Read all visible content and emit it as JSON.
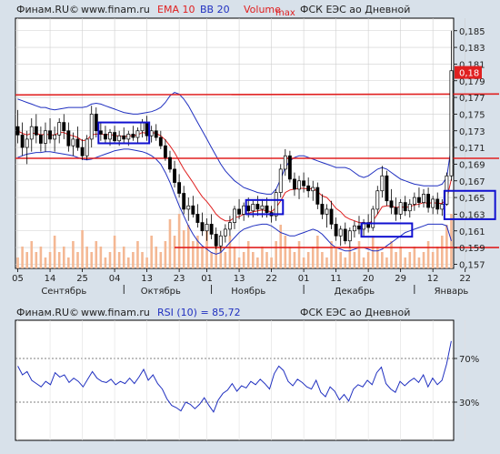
{
  "main_header": {
    "source": "Финам.RU©",
    "site": "www.finam.ru",
    "ema": "EMA 10",
    "bb": "BB 20",
    "volume": "Volume",
    "max": "max",
    "ticker": "ФСК ЕЭС ао Дневной"
  },
  "rsi_header": {
    "source": "Финам.RU©",
    "site": "www.finam.ru",
    "rsi": "RSI (10) = 85,72",
    "ticker": "ФСК ЕЭС ао Дневной"
  },
  "colors": {
    "background": "#d8e1ea",
    "plot": "#ffffff",
    "candle_up": "#ffffff",
    "candle_down": "#000000",
    "ema": "#e02020",
    "bollinger": "#2030c0",
    "volume": "#f4b894",
    "levels": "#e02020",
    "boxes": "#1010d0",
    "rsi": "#2030c0",
    "last_price_bg": "#e02020"
  },
  "chart_data": [
    {
      "type": "candlestick",
      "title": "ФСК ЕЭС ао Дневной",
      "ylim": [
        0.1565,
        0.1865
      ],
      "y_ticks": [
        "0,185",
        "0,183",
        "0,181",
        "0,179",
        "0,177",
        "0,175",
        "0,173",
        "0,171",
        "0,169",
        "0,167",
        "0,165",
        "0,163",
        "0,161",
        "0,159",
        "0,157"
      ],
      "y_tick_values": [
        0.185,
        0.183,
        0.181,
        0.179,
        0.177,
        0.175,
        0.173,
        0.171,
        0.169,
        0.167,
        0.165,
        0.163,
        0.161,
        0.159,
        0.157
      ],
      "x_ticks": [
        "05",
        "14",
        "25",
        "04",
        "13",
        "23",
        "01",
        "13",
        "22",
        "01",
        "11",
        "20",
        "29",
        "12",
        "22"
      ],
      "months": [
        "Сентябрь",
        "Октябрь",
        "Ноябрь",
        "Декабрь",
        "Январь"
      ],
      "last_price_label": "0,18",
      "last_price": 0.18,
      "horizontal_levels": [
        0.1773,
        0.1697,
        0.159
      ],
      "legend": [
        "EMA 10",
        "BB 20",
        "Volume",
        "max"
      ],
      "grid": true,
      "candles": [
        [
          0.1735,
          0.1755,
          0.1715,
          0.1725
        ],
        [
          0.1725,
          0.174,
          0.17,
          0.171
        ],
        [
          0.171,
          0.173,
          0.169,
          0.172
        ],
        [
          0.172,
          0.1745,
          0.1705,
          0.1735
        ],
        [
          0.1735,
          0.175,
          0.1715,
          0.1725
        ],
        [
          0.1725,
          0.1735,
          0.1705,
          0.1715
        ],
        [
          0.1715,
          0.174,
          0.1705,
          0.173
        ],
        [
          0.173,
          0.1745,
          0.1715,
          0.172
        ],
        [
          0.172,
          0.1735,
          0.1705,
          0.1725
        ],
        [
          0.1725,
          0.1745,
          0.1715,
          0.174
        ],
        [
          0.174,
          0.175,
          0.172,
          0.173
        ],
        [
          0.173,
          0.174,
          0.1705,
          0.1712
        ],
        [
          0.1712,
          0.1728,
          0.17,
          0.172
        ],
        [
          0.172,
          0.1735,
          0.1706,
          0.171
        ],
        [
          0.171,
          0.172,
          0.1695,
          0.17
        ],
        [
          0.17,
          0.1725,
          0.1695,
          0.172
        ],
        [
          0.172,
          0.176,
          0.171,
          0.175
        ],
        [
          0.175,
          0.1758,
          0.1722,
          0.173
        ],
        [
          0.173,
          0.174,
          0.1718,
          0.1726
        ],
        [
          0.1726,
          0.1736,
          0.1714,
          0.172
        ],
        [
          0.172,
          0.1732,
          0.1712,
          0.1728
        ],
        [
          0.1728,
          0.1736,
          0.1714,
          0.1718
        ],
        [
          0.1718,
          0.173,
          0.1712,
          0.1724
        ],
        [
          0.1724,
          0.1734,
          0.1716,
          0.172
        ],
        [
          0.172,
          0.173,
          0.1712,
          0.1726
        ],
        [
          0.1726,
          0.1736,
          0.1718,
          0.1722
        ],
        [
          0.1722,
          0.1734,
          0.1716,
          0.173
        ],
        [
          0.173,
          0.1744,
          0.1722,
          0.174
        ],
        [
          0.174,
          0.1748,
          0.1718,
          0.1724
        ],
        [
          0.1724,
          0.1736,
          0.1716,
          0.173
        ],
        [
          0.173,
          0.1738,
          0.1718,
          0.1722
        ],
        [
          0.1722,
          0.173,
          0.1708,
          0.1712
        ],
        [
          0.1712,
          0.172,
          0.1694,
          0.1698
        ],
        [
          0.1698,
          0.1706,
          0.168,
          0.1684
        ],
        [
          0.1684,
          0.1694,
          0.1662,
          0.1668
        ],
        [
          0.1668,
          0.1678,
          0.165,
          0.1655
        ],
        [
          0.1655,
          0.1664,
          0.163,
          0.1636
        ],
        [
          0.1636,
          0.165,
          0.1622,
          0.164
        ],
        [
          0.164,
          0.1652,
          0.1626,
          0.163
        ],
        [
          0.163,
          0.1642,
          0.1614,
          0.162
        ],
        [
          0.162,
          0.1632,
          0.1604,
          0.161
        ],
        [
          0.161,
          0.1625,
          0.1598,
          0.1618
        ],
        [
          0.1618,
          0.163,
          0.16,
          0.1606
        ],
        [
          0.1606,
          0.1614,
          0.1588,
          0.1592
        ],
        [
          0.1592,
          0.161,
          0.1585,
          0.1604
        ],
        [
          0.1604,
          0.1618,
          0.1596,
          0.1612
        ],
        [
          0.1612,
          0.1628,
          0.1604,
          0.162
        ],
        [
          0.162,
          0.164,
          0.1612,
          0.1636
        ],
        [
          0.1636,
          0.1648,
          0.1624,
          0.163
        ],
        [
          0.163,
          0.1644,
          0.1622,
          0.164
        ],
        [
          0.164,
          0.165,
          0.1626,
          0.1634
        ],
        [
          0.1634,
          0.1646,
          0.1626,
          0.1642
        ],
        [
          0.1642,
          0.1652,
          0.1628,
          0.1636
        ],
        [
          0.1636,
          0.1648,
          0.1626,
          0.164
        ],
        [
          0.164,
          0.165,
          0.1626,
          0.1632
        ],
        [
          0.1632,
          0.164,
          0.162,
          0.1628
        ],
        [
          0.1628,
          0.166,
          0.1622,
          0.1656
        ],
        [
          0.1656,
          0.169,
          0.165,
          0.1684
        ],
        [
          0.1684,
          0.1708,
          0.1676,
          0.17
        ],
        [
          0.17,
          0.1706,
          0.1668,
          0.1672
        ],
        [
          0.1672,
          0.168,
          0.1652,
          0.166
        ],
        [
          0.166,
          0.1676,
          0.1648,
          0.167
        ],
        [
          0.167,
          0.168,
          0.1656,
          0.1664
        ],
        [
          0.1664,
          0.1674,
          0.165,
          0.1658
        ],
        [
          0.1658,
          0.167,
          0.1646,
          0.1662
        ],
        [
          0.1662,
          0.1668,
          0.1636,
          0.1642
        ],
        [
          0.1642,
          0.1654,
          0.1624,
          0.163
        ],
        [
          0.163,
          0.1642,
          0.1614,
          0.1636
        ],
        [
          0.1636,
          0.1646,
          0.1612,
          0.1618
        ],
        [
          0.1618,
          0.1626,
          0.1598,
          0.1604
        ],
        [
          0.1604,
          0.1616,
          0.1592,
          0.1612
        ],
        [
          0.1612,
          0.162,
          0.1594,
          0.1598
        ],
        [
          0.1598,
          0.1614,
          0.159,
          0.161
        ],
        [
          0.161,
          0.1622,
          0.1602,
          0.1616
        ],
        [
          0.1616,
          0.1628,
          0.1606,
          0.1612
        ],
        [
          0.1612,
          0.1624,
          0.1604,
          0.162
        ],
        [
          0.162,
          0.163,
          0.1608,
          0.1614
        ],
        [
          0.1614,
          0.164,
          0.161,
          0.1636
        ],
        [
          0.1636,
          0.1664,
          0.163,
          0.1658
        ],
        [
          0.1658,
          0.1688,
          0.165,
          0.1676
        ],
        [
          0.1676,
          0.1682,
          0.164,
          0.1646
        ],
        [
          0.1646,
          0.166,
          0.163,
          0.1638
        ],
        [
          0.1638,
          0.165,
          0.1622,
          0.163
        ],
        [
          0.163,
          0.1648,
          0.1624,
          0.1644
        ],
        [
          0.1644,
          0.1652,
          0.1628,
          0.1634
        ],
        [
          0.1634,
          0.1648,
          0.1626,
          0.1642
        ],
        [
          0.1642,
          0.1656,
          0.1634,
          0.165
        ],
        [
          0.165,
          0.1662,
          0.1638,
          0.1644
        ],
        [
          0.1644,
          0.166,
          0.1638,
          0.1654
        ],
        [
          0.1654,
          0.1662,
          0.1632,
          0.1638
        ],
        [
          0.1638,
          0.1652,
          0.163,
          0.1648
        ],
        [
          0.1648,
          0.1656,
          0.163,
          0.1636
        ],
        [
          0.1636,
          0.1648,
          0.1628,
          0.1642
        ],
        [
          0.1642,
          0.168,
          0.164,
          0.1676
        ],
        [
          0.1676,
          0.185,
          0.167,
          0.1802
        ]
      ],
      "ema": [
        0.173,
        0.1727,
        0.1725,
        0.1727,
        0.1727,
        0.1725,
        0.1726,
        0.1725,
        0.1725,
        0.1728,
        0.1728,
        0.1725,
        0.1724,
        0.1722,
        0.1718,
        0.1719,
        0.1725,
        0.1726,
        0.1726,
        0.1725,
        0.1726,
        0.1724,
        0.1724,
        0.1723,
        0.1724,
        0.1724,
        0.1725,
        0.1728,
        0.1727,
        0.1728,
        0.1727,
        0.1724,
        0.1719,
        0.1712,
        0.1704,
        0.1694,
        0.1684,
        0.1676,
        0.1668,
        0.1659,
        0.1651,
        0.1645,
        0.1638,
        0.163,
        0.1625,
        0.1622,
        0.1622,
        0.1626,
        0.1627,
        0.163,
        0.1631,
        0.1633,
        0.1634,
        0.1635,
        0.1634,
        0.1633,
        0.1638,
        0.1646,
        0.1656,
        0.1659,
        0.166,
        0.1661,
        0.1661,
        0.166,
        0.1661,
        0.1657,
        0.1652,
        0.165,
        0.1644,
        0.1637,
        0.1633,
        0.1627,
        0.1624,
        0.1622,
        0.162,
        0.162,
        0.1619,
        0.1622,
        0.163,
        0.1639,
        0.164,
        0.164,
        0.1638,
        0.1639,
        0.1638,
        0.1639,
        0.1641,
        0.1642,
        0.1644,
        0.1643,
        0.1644,
        0.1643,
        0.1643,
        0.1648,
        0.1672
      ],
      "bb_upper": [
        0.1768,
        0.1766,
        0.1764,
        0.1762,
        0.176,
        0.1758,
        0.1758,
        0.1756,
        0.1755,
        0.1756,
        0.1757,
        0.1758,
        0.1758,
        0.1758,
        0.1758,
        0.1759,
        0.1762,
        0.1763,
        0.1762,
        0.176,
        0.1758,
        0.1756,
        0.1754,
        0.1752,
        0.1751,
        0.175,
        0.175,
        0.1751,
        0.1752,
        0.1753,
        0.1755,
        0.1758,
        0.1764,
        0.1772,
        0.1776,
        0.1774,
        0.1768,
        0.176,
        0.175,
        0.174,
        0.173,
        0.172,
        0.171,
        0.17,
        0.169,
        0.1682,
        0.1676,
        0.167,
        0.1666,
        0.1662,
        0.166,
        0.1658,
        0.1656,
        0.1655,
        0.1654,
        0.1654,
        0.166,
        0.1672,
        0.1686,
        0.1694,
        0.1698,
        0.17,
        0.17,
        0.1698,
        0.1696,
        0.1694,
        0.1692,
        0.169,
        0.1688,
        0.1686,
        0.1686,
        0.1686,
        0.1684,
        0.168,
        0.1676,
        0.1674,
        0.1676,
        0.168,
        0.1684,
        0.1686,
        0.1684,
        0.168,
        0.1676,
        0.1672,
        0.167,
        0.1668,
        0.1666,
        0.1665,
        0.1664,
        0.1664,
        0.1664,
        0.1664,
        0.1666,
        0.1674,
        0.1712
      ],
      "bb_lower": [
        0.1698,
        0.17,
        0.1702,
        0.1703,
        0.1704,
        0.1704,
        0.1705,
        0.1705,
        0.1704,
        0.1703,
        0.1702,
        0.1701,
        0.17,
        0.1698,
        0.1696,
        0.1695,
        0.1696,
        0.1698,
        0.17,
        0.1702,
        0.1704,
        0.1706,
        0.1707,
        0.1708,
        0.1708,
        0.1707,
        0.1706,
        0.1705,
        0.1703,
        0.17,
        0.1696,
        0.169,
        0.168,
        0.1668,
        0.1654,
        0.164,
        0.1628,
        0.1616,
        0.1606,
        0.1598,
        0.1592,
        0.1588,
        0.1584,
        0.1582,
        0.1584,
        0.159,
        0.1596,
        0.1602,
        0.1608,
        0.1612,
        0.1614,
        0.1616,
        0.1617,
        0.1618,
        0.1618,
        0.1616,
        0.1612,
        0.1608,
        0.1606,
        0.1604,
        0.1604,
        0.1606,
        0.1608,
        0.161,
        0.1612,
        0.161,
        0.1606,
        0.16,
        0.1594,
        0.159,
        0.1588,
        0.1586,
        0.1586,
        0.1588,
        0.159,
        0.159,
        0.1588,
        0.1586,
        0.1586,
        0.1588,
        0.1592,
        0.1596,
        0.16,
        0.1604,
        0.1608,
        0.161,
        0.1612,
        0.1614,
        0.1616,
        0.1618,
        0.1618,
        0.1618,
        0.1618,
        0.1616,
        0.1598
      ],
      "volume": [
        0.2,
        0.4,
        0.3,
        0.5,
        0.3,
        0.4,
        0.2,
        0.3,
        0.6,
        0.3,
        0.4,
        0.2,
        0.5,
        0.3,
        0.7,
        0.4,
        0.3,
        0.5,
        0.4,
        0.2,
        0.3,
        0.6,
        0.3,
        0.4,
        0.2,
        0.3,
        0.5,
        0.3,
        0.2,
        0.6,
        0.4,
        0.3,
        0.5,
        0.9,
        0.6,
        1.0,
        0.7,
        0.8,
        0.5,
        0.6,
        0.4,
        0.7,
        0.3,
        0.5,
        0.4,
        0.3,
        0.6,
        0.4,
        0.2,
        0.3,
        0.5,
        0.3,
        0.2,
        0.4,
        0.3,
        0.2,
        0.5,
        0.8,
        0.6,
        0.4,
        0.3,
        0.5,
        0.2,
        0.3,
        0.4,
        0.6,
        0.3,
        0.2,
        0.5,
        0.4,
        0.3,
        0.2,
        0.4,
        0.3,
        0.5,
        0.2,
        0.3,
        0.6,
        0.4,
        0.3,
        0.2,
        0.5,
        0.3,
        0.4,
        0.2,
        0.3,
        0.4,
        0.2,
        0.3,
        0.5,
        0.3,
        0.4,
        0.6,
        0.8,
        1.0
      ],
      "boxes": [
        {
          "from": 18,
          "to": 28,
          "low": 0.1715,
          "high": 0.174
        },
        {
          "from": 50,
          "to": 57,
          "low": 0.163,
          "high": 0.1647
        },
        {
          "from": 75,
          "to": 85,
          "low": 0.1603,
          "high": 0.1619
        },
        {
          "from": 93,
          "to": 103,
          "low": 0.1624,
          "high": 0.1658
        }
      ]
    },
    {
      "type": "line",
      "title": "RSI (10) = 85,72",
      "ylim": [
        0,
        100
      ],
      "y_ticks": [
        "70%",
        "30%"
      ],
      "y_tick_values": [
        70,
        30
      ],
      "last_value": 85.72,
      "values": [
        63,
        55,
        58,
        50,
        47,
        44,
        49,
        46,
        57,
        53,
        55,
        48,
        52,
        49,
        44,
        51,
        58,
        52,
        49,
        48,
        51,
        46,
        49,
        47,
        52,
        47,
        53,
        60,
        50,
        55,
        47,
        42,
        33,
        27,
        25,
        22,
        30,
        28,
        24,
        28,
        34,
        27,
        21,
        32,
        38,
        41,
        47,
        40,
        45,
        43,
        49,
        46,
        51,
        47,
        42,
        56,
        63,
        59,
        49,
        45,
        51,
        48,
        44,
        42,
        50,
        39,
        35,
        44,
        40,
        32,
        37,
        31,
        42,
        46,
        44,
        50,
        46,
        57,
        62,
        47,
        42,
        39,
        49,
        45,
        49,
        52,
        48,
        55,
        44,
        52,
        46,
        50,
        65,
        86
      ]
    }
  ]
}
